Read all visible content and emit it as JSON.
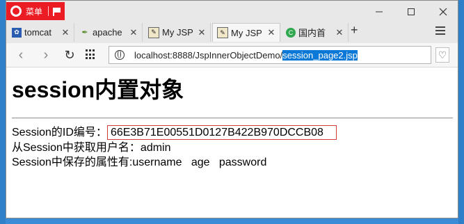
{
  "browser": {
    "menu_label": "菜单",
    "tabs": [
      {
        "label": "tomcat",
        "icon": "paw-icon"
      },
      {
        "label": "apache",
        "icon": "feather-icon"
      },
      {
        "label": "My JSP",
        "icon": "jsp-page-icon"
      },
      {
        "label": "My JSP",
        "icon": "jsp-page-icon",
        "active": true
      },
      {
        "label": "国内首",
        "icon": "green-site-icon"
      }
    ],
    "url_base": "localhost:8888/JspInnerObjectDemo/",
    "url_selected": "session_page2.jsp"
  },
  "page": {
    "heading": "session内置对象",
    "session_id_label": "Session的ID编号：",
    "session_id_value": "66E3B71E00551D0127B422B970DCCB08",
    "username_line": "从Session中获取用户名：admin",
    "attributes_line": "Session中保存的属性有:username   age   password"
  }
}
